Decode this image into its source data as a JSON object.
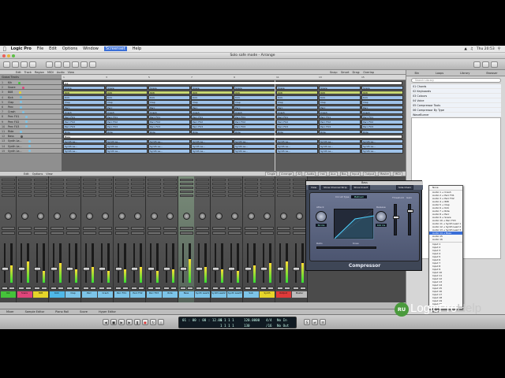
{
  "menubar": {
    "app": "Logic Pro",
    "items": [
      "File",
      "Edit",
      "Options",
      "Window",
      "Screenset",
      "Help"
    ],
    "active_item": "Screenset",
    "clock": "Thu 20:53"
  },
  "window": {
    "title": "Solo safe mode - Arrange"
  },
  "arrange": {
    "menu": [
      "Edit",
      "Track",
      "Region",
      "MIDI",
      "Audio",
      "View"
    ],
    "snap_label": "Snap:",
    "snap_value": "Smart",
    "drag_label": "Drag:",
    "drag_value": "Overlap",
    "ruler": [
      "1",
      "3",
      "5",
      "7",
      "9",
      "11",
      "13",
      "15"
    ],
    "global_tracks": "Global Tracks",
    "tracks": [
      {
        "num": "1",
        "name": "Kik"
      },
      {
        "num": "2",
        "name": "Snare"
      },
      {
        "num": "3",
        "name": "808"
      },
      {
        "num": "4",
        "name": "Kick"
      },
      {
        "num": "5",
        "name": "Clap"
      },
      {
        "num": "6",
        "name": "Perc"
      },
      {
        "num": "7",
        "name": "Crash"
      },
      {
        "num": "8",
        "name": "Perc FX1"
      },
      {
        "num": "9",
        "name": "Perc FX2"
      },
      {
        "num": "10",
        "name": "Perc FX3"
      },
      {
        "num": "11",
        "name": "Ride"
      },
      {
        "num": "12",
        "name": "Bass"
      },
      {
        "num": "13",
        "name": "Synth Le..."
      },
      {
        "num": "14",
        "name": "Synth Le..."
      },
      {
        "num": "15",
        "name": "Synth Le..."
      }
    ]
  },
  "mixer": {
    "menu": [
      "Edit",
      "Options",
      "View"
    ],
    "filters": [
      "Single",
      "Arrange",
      "All",
      "Audio",
      "Inst",
      "Aux",
      "Bus",
      "Input",
      "Output",
      "Master",
      "MIDI"
    ],
    "strips": [
      {
        "name": "Kik",
        "color": "#45c33a"
      },
      {
        "name": "Snare",
        "color": "#e0457a"
      },
      {
        "name": "808",
        "color": "#e6d52a"
      },
      {
        "name": "Kick",
        "color": "#4fb8e8"
      },
      {
        "name": "Clap",
        "color": "#7cc4e8"
      },
      {
        "name": "Perc",
        "color": "#7cc4e8"
      },
      {
        "name": "Crash",
        "color": "#7cc4e8"
      },
      {
        "name": "Perc FX1",
        "color": "#7cc4e8"
      },
      {
        "name": "Perc FX2",
        "color": "#7cc4e8"
      },
      {
        "name": "Perc FX3",
        "color": "#7cc4e8"
      },
      {
        "name": "Ride",
        "color": "#7cc4e8"
      },
      {
        "name": "Bass",
        "color": "#7cc4e8"
      },
      {
        "name": "Synth Lead1",
        "color": "#7cc4e8"
      },
      {
        "name": "Synth Lead2",
        "color": "#7cc4e8"
      },
      {
        "name": "Synth Lead3",
        "color": "#7cc4e8"
      },
      {
        "name": "Sub",
        "color": "#7cc4e8"
      },
      {
        "name": "Synth",
        "color": "#e6d52a"
      },
      {
        "name": "Output",
        "color": "#e03a3a"
      },
      {
        "name": "Master",
        "color": "#bbbbbb"
      }
    ]
  },
  "plugin": {
    "title": "Bass",
    "preset_bar": [
      "View",
      "Show Channel Strip",
      "Show Insert"
    ],
    "sidechain": "Side Chain",
    "circuit_label": "Circuit Type",
    "circuit_value": "Platinum",
    "attack_label": "Attack",
    "release_label": "Release",
    "ratio_label": "Ratio",
    "knee_label": "Knee",
    "gain_label": "Gain",
    "attack_value": "50 ms",
    "release_value": "100 ms",
    "threshold_label": "Threshold",
    "name": "Compressor"
  },
  "dropdown": {
    "items": [
      "None",
      "Audio 1 → Crash",
      "Audio 2 → Perc FX1",
      "Audio 3 → Perc FX2",
      "Audio 4 → 808",
      "Audio 5 → Clap",
      "Audio 6 → Kick",
      "Audio 7 → Ride",
      "Audio 8 → Perc",
      "Audio 9 → Snare",
      "Audio 10 → Perc FX3",
      "Audio 11 → Synth Lead 1",
      "Audio 12 → Synth Lead 2",
      "Audio 13 → Synth Lead 3",
      "Audio 14 → Bass",
      "Audio 15",
      "Audio 16"
    ],
    "selected": "Audio 14 → Bass",
    "inputs": [
      "Input 1",
      "Input 2",
      "Input 3",
      "Input 4",
      "Input 5",
      "Input 6",
      "Input 7",
      "Input 8",
      "Input 9",
      "Input 10",
      "Input 11",
      "Input 12",
      "Input 13",
      "Input 14",
      "Input 15",
      "Input 16",
      "Input 17",
      "Input 18",
      "Input 19",
      "Input 20"
    ],
    "buses": [
      "Bus 1",
      "Bus 2",
      "Bus 3"
    ]
  },
  "library": {
    "tabs": [
      "Bin",
      "Loops",
      "Library",
      "Browser"
    ],
    "search_placeholder": "Search Library",
    "items": [
      "01 Chords",
      "02 Keyboards",
      "03 Colours",
      "04 Voice",
      "05 Compressor Tools",
      "06 Compressor By Type",
      "WaveBurner"
    ]
  },
  "bottom_tabs": [
    "Mixer",
    "Sample Editor",
    "Piano Roll",
    "Score",
    "Hyper Editor"
  ],
  "transport": {
    "time": "01 : 00 : 00 : 12.06",
    "bars": "1  1  1  1",
    "tempo": "120.0000",
    "signature": "4/4",
    "division": "/16",
    "in_label": "No In",
    "out_label": "No Out",
    "row2_bars": "1  1  1  1",
    "row2_tempo": "130"
  },
  "logo": {
    "prefix": "RU",
    "main": "LogicPro",
    "suffix": "Help"
  },
  "colors": {
    "region_green": "#c8d873",
    "region_blue": "#9fc3ea",
    "accent": "#3a6fd8"
  }
}
